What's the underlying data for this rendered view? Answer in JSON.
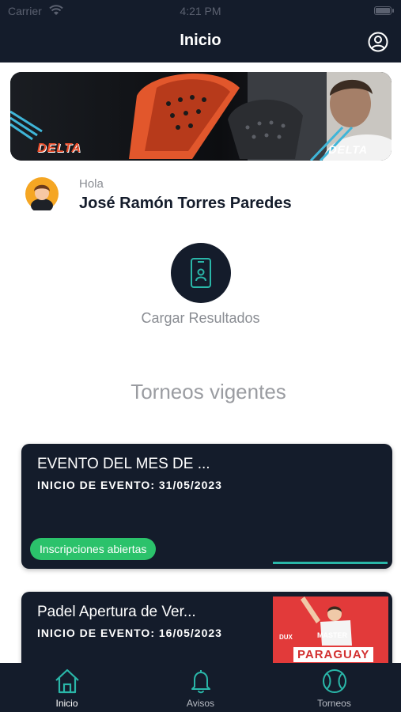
{
  "status_bar": {
    "carrier": "Carrier",
    "time": "4:21 PM"
  },
  "header": {
    "title": "Inicio"
  },
  "banner": {
    "brand_left": "DELTA",
    "brand_right": "DELTA"
  },
  "greeting": {
    "hello": "Hola",
    "name": "José Ramón Torres Paredes"
  },
  "actions": {
    "upload_results_label": "Cargar Resultados"
  },
  "tournaments": {
    "section_title": "Torneos vigentes",
    "items": [
      {
        "title": "EVENTO DEL MES DE ...",
        "date": "INICIO DE EVENTO: 31/05/2023",
        "badge": "Inscripciones abiertas",
        "progress": 1.0
      },
      {
        "title": "Padel Apertura de Ver...",
        "date": "INICIO DE EVENTO: 16/05/2023",
        "image_label": "PARAGUAY",
        "image_sublabel": "MASTER"
      }
    ]
  },
  "tabbar": {
    "items": [
      {
        "label": "Inicio",
        "icon": "home-icon",
        "active": true
      },
      {
        "label": "Avisos",
        "icon": "bell-icon",
        "active": false
      },
      {
        "label": "Torneos",
        "icon": "tennis-ball-icon",
        "active": false
      }
    ]
  },
  "colors": {
    "navy": "#141c2b",
    "teal": "#2ab7a9",
    "green_badge": "#2bc26b",
    "gray_text": "#8a8d93"
  }
}
